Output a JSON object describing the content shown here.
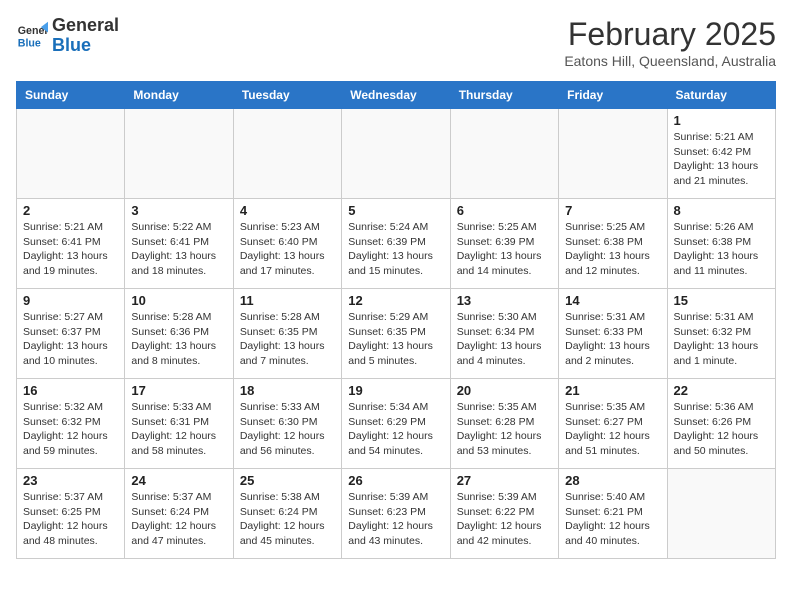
{
  "header": {
    "logo_general": "General",
    "logo_blue": "Blue",
    "month_title": "February 2025",
    "subtitle": "Eatons Hill, Queensland, Australia"
  },
  "weekdays": [
    "Sunday",
    "Monday",
    "Tuesday",
    "Wednesday",
    "Thursday",
    "Friday",
    "Saturday"
  ],
  "weeks": [
    [
      {
        "day": "",
        "info": ""
      },
      {
        "day": "",
        "info": ""
      },
      {
        "day": "",
        "info": ""
      },
      {
        "day": "",
        "info": ""
      },
      {
        "day": "",
        "info": ""
      },
      {
        "day": "",
        "info": ""
      },
      {
        "day": "1",
        "info": "Sunrise: 5:21 AM\nSunset: 6:42 PM\nDaylight: 13 hours\nand 21 minutes."
      }
    ],
    [
      {
        "day": "2",
        "info": "Sunrise: 5:21 AM\nSunset: 6:41 PM\nDaylight: 13 hours\nand 19 minutes."
      },
      {
        "day": "3",
        "info": "Sunrise: 5:22 AM\nSunset: 6:41 PM\nDaylight: 13 hours\nand 18 minutes."
      },
      {
        "day": "4",
        "info": "Sunrise: 5:23 AM\nSunset: 6:40 PM\nDaylight: 13 hours\nand 17 minutes."
      },
      {
        "day": "5",
        "info": "Sunrise: 5:24 AM\nSunset: 6:39 PM\nDaylight: 13 hours\nand 15 minutes."
      },
      {
        "day": "6",
        "info": "Sunrise: 5:25 AM\nSunset: 6:39 PM\nDaylight: 13 hours\nand 14 minutes."
      },
      {
        "day": "7",
        "info": "Sunrise: 5:25 AM\nSunset: 6:38 PM\nDaylight: 13 hours\nand 12 minutes."
      },
      {
        "day": "8",
        "info": "Sunrise: 5:26 AM\nSunset: 6:38 PM\nDaylight: 13 hours\nand 11 minutes."
      }
    ],
    [
      {
        "day": "9",
        "info": "Sunrise: 5:27 AM\nSunset: 6:37 PM\nDaylight: 13 hours\nand 10 minutes."
      },
      {
        "day": "10",
        "info": "Sunrise: 5:28 AM\nSunset: 6:36 PM\nDaylight: 13 hours\nand 8 minutes."
      },
      {
        "day": "11",
        "info": "Sunrise: 5:28 AM\nSunset: 6:35 PM\nDaylight: 13 hours\nand 7 minutes."
      },
      {
        "day": "12",
        "info": "Sunrise: 5:29 AM\nSunset: 6:35 PM\nDaylight: 13 hours\nand 5 minutes."
      },
      {
        "day": "13",
        "info": "Sunrise: 5:30 AM\nSunset: 6:34 PM\nDaylight: 13 hours\nand 4 minutes."
      },
      {
        "day": "14",
        "info": "Sunrise: 5:31 AM\nSunset: 6:33 PM\nDaylight: 13 hours\nand 2 minutes."
      },
      {
        "day": "15",
        "info": "Sunrise: 5:31 AM\nSunset: 6:32 PM\nDaylight: 13 hours\nand 1 minute."
      }
    ],
    [
      {
        "day": "16",
        "info": "Sunrise: 5:32 AM\nSunset: 6:32 PM\nDaylight: 12 hours\nand 59 minutes."
      },
      {
        "day": "17",
        "info": "Sunrise: 5:33 AM\nSunset: 6:31 PM\nDaylight: 12 hours\nand 58 minutes."
      },
      {
        "day": "18",
        "info": "Sunrise: 5:33 AM\nSunset: 6:30 PM\nDaylight: 12 hours\nand 56 minutes."
      },
      {
        "day": "19",
        "info": "Sunrise: 5:34 AM\nSunset: 6:29 PM\nDaylight: 12 hours\nand 54 minutes."
      },
      {
        "day": "20",
        "info": "Sunrise: 5:35 AM\nSunset: 6:28 PM\nDaylight: 12 hours\nand 53 minutes."
      },
      {
        "day": "21",
        "info": "Sunrise: 5:35 AM\nSunset: 6:27 PM\nDaylight: 12 hours\nand 51 minutes."
      },
      {
        "day": "22",
        "info": "Sunrise: 5:36 AM\nSunset: 6:26 PM\nDaylight: 12 hours\nand 50 minutes."
      }
    ],
    [
      {
        "day": "23",
        "info": "Sunrise: 5:37 AM\nSunset: 6:25 PM\nDaylight: 12 hours\nand 48 minutes."
      },
      {
        "day": "24",
        "info": "Sunrise: 5:37 AM\nSunset: 6:24 PM\nDaylight: 12 hours\nand 47 minutes."
      },
      {
        "day": "25",
        "info": "Sunrise: 5:38 AM\nSunset: 6:24 PM\nDaylight: 12 hours\nand 45 minutes."
      },
      {
        "day": "26",
        "info": "Sunrise: 5:39 AM\nSunset: 6:23 PM\nDaylight: 12 hours\nand 43 minutes."
      },
      {
        "day": "27",
        "info": "Sunrise: 5:39 AM\nSunset: 6:22 PM\nDaylight: 12 hours\nand 42 minutes."
      },
      {
        "day": "28",
        "info": "Sunrise: 5:40 AM\nSunset: 6:21 PM\nDaylight: 12 hours\nand 40 minutes."
      },
      {
        "day": "",
        "info": ""
      }
    ]
  ]
}
